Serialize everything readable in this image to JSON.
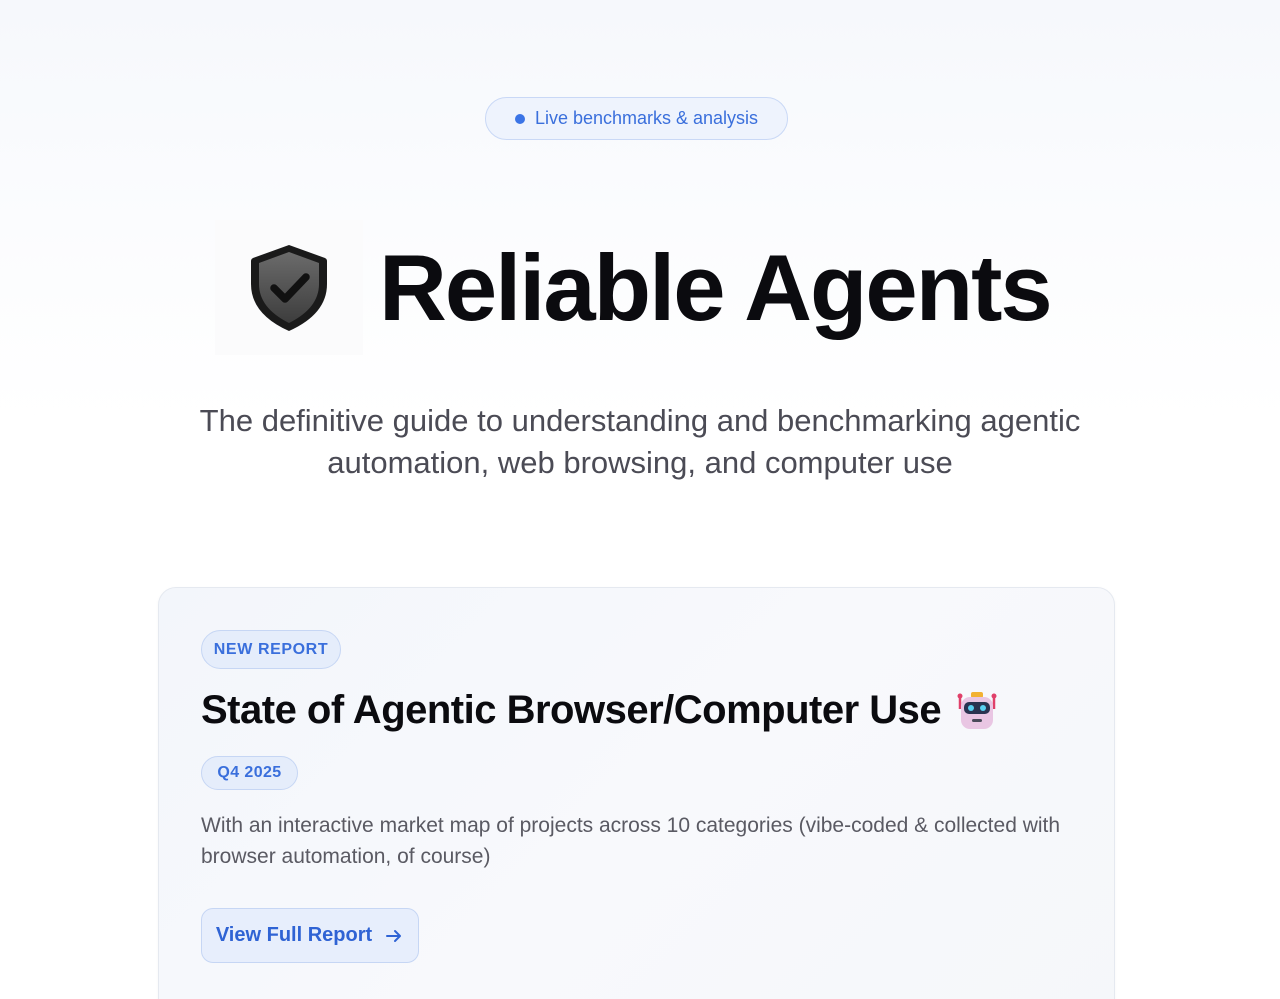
{
  "hero": {
    "badge_label": "Live benchmarks & analysis",
    "title": "Reliable Agents",
    "logo_icon": "shield-check-icon",
    "subtitle": "The definitive guide to understanding and benchmarking agentic automation, web browsing, and computer use"
  },
  "report": {
    "badge": "NEW REPORT",
    "title": "State of Agentic Browser/Computer Use",
    "title_icon": "robot-icon",
    "quarter": "Q4 2025",
    "description": "With an interactive market map of projects across 10 categories (vibe-coded & collected with browser automation, of course)",
    "cta_label": "View Full Report",
    "cta_icon": "arrow-right-icon"
  },
  "colors": {
    "accent": "#3a6fdc",
    "accent_bg": "#e5edfb",
    "title_text": "#0b0b0f",
    "body_text": "#5a5a63"
  }
}
